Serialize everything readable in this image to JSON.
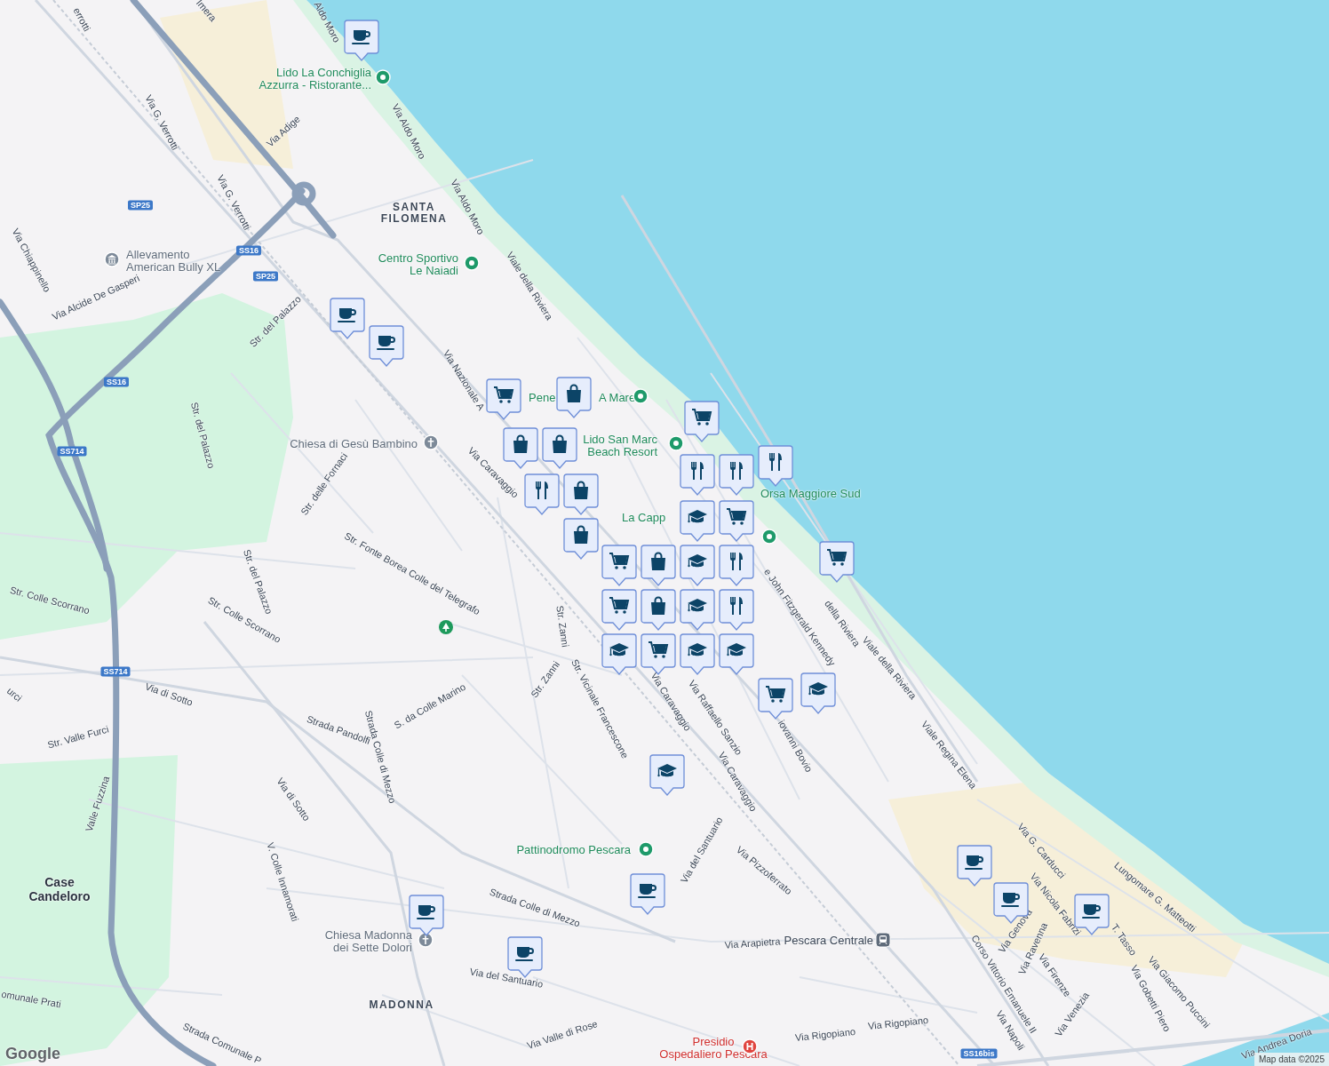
{
  "map": {
    "street_labels": [
      "errotti",
      "Imera",
      "Aldo Moro",
      "Via G. Verrotti",
      "Via Adige",
      "Via Aldo Moro",
      "Via G. Verrotti",
      "Via Aldo Moro",
      "Viale della Riviera",
      "Via Chiappinello",
      "Via Alcide De Gasperi",
      "Str. del Palazzo",
      "Via Nazionale A",
      "Str. del Palazzo",
      "Str. delle Fornaci",
      "Via Caravaggio",
      "Str. Fonte Borea Colle del Telegrafo",
      "Str. del Palazzo",
      "Str. Colle Scorrano",
      "Str. Colle Scorrano",
      "Str. Zanni",
      "Str. Zanni",
      "Str. Vicinale Francescone",
      "Via Caravaggio",
      "Via Raffaello Sanzio",
      "iovanni Bovio",
      "e John Fitzgerald Kennedy",
      "della Riviera",
      "Viale della Riviera",
      "Viale Regina Elena",
      "urci",
      "Via di Sotto",
      "Strada Pandolfi",
      "S. da Colle Marino",
      "Strada Colle di Mezzo",
      "Str. Valle Furci",
      "Valle Fuzzina",
      "Via di Sotto",
      "V. Colle Innamorati",
      "Via Caravaggio",
      "Via del Santuario",
      "Via Pizzoferrato",
      "Strada Colle di Mezzo",
      "Via Arapietra",
      "Via del Santuario",
      "Via Valle di Rose",
      "Via Rigopiano",
      "Via Rigopiano",
      "Strada Comunale P",
      "omunale Prati",
      "Via G. Carducci",
      "Via Nicola Fabrizi",
      "Lungomare G. Matteotti",
      "Via Genova",
      "Via Ravenna",
      "Corso Vittorio Emanuele II",
      "Via Firenze",
      "T. Tasso",
      "Via Giacomo Puccini",
      "Via Gobetti Piero",
      "Via Venezia",
      "Via Napoli",
      "Via Andrea Doria"
    ],
    "places": [
      {
        "kind": "poi",
        "lines": [
          "Lido La Conchiglia",
          "Azzurra -  Ristorante..."
        ]
      },
      {
        "kind": "poi",
        "lines": [
          "Centro Sportivo",
          "Le Naiadi"
        ]
      },
      {
        "kind": "poi",
        "lines": [
          "Pene"
        ]
      },
      {
        "kind": "poi",
        "lines": [
          "A Mare"
        ]
      },
      {
        "kind": "poi",
        "lines": [
          "Lido San Marc",
          "Beach Resort"
        ]
      },
      {
        "kind": "poi",
        "lines": [
          "Orsa Maggiore Sud"
        ]
      },
      {
        "kind": "poi",
        "lines": [
          "La Capp"
        ]
      },
      {
        "kind": "poi",
        "lines": [
          "Pattinodromo Pescara"
        ]
      },
      {
        "kind": "museum",
        "lines": [
          "Allevamento",
          "American Bully XL"
        ]
      },
      {
        "kind": "church",
        "lines": [
          "Chiesa di Gesù Bambino"
        ]
      },
      {
        "kind": "church",
        "lines": [
          "Chiesa Madonna",
          "dei Sette Dolori"
        ]
      },
      {
        "kind": "station",
        "lines": [
          "Pescara Centrale"
        ]
      },
      {
        "kind": "hospital",
        "lines": [
          "Presidio",
          "Ospedaliero Pescara"
        ]
      },
      {
        "kind": "area",
        "lines": [
          "SANTA",
          "FILOMENA"
        ]
      },
      {
        "kind": "town",
        "lines": [
          "Case",
          "Candeloro"
        ]
      },
      {
        "kind": "area",
        "lines": [
          "MADONNA"
        ]
      }
    ],
    "road_shields": [
      "SP25",
      "SS16",
      "SP25",
      "SS16",
      "SS714",
      "SS714",
      "SS16bis"
    ],
    "markers": [
      {
        "kind": "cafe"
      },
      {
        "kind": "cafe"
      },
      {
        "kind": "cafe"
      },
      {
        "kind": "cart"
      },
      {
        "kind": "bag"
      },
      {
        "kind": "bag"
      },
      {
        "kind": "bag"
      },
      {
        "kind": "fork"
      },
      {
        "kind": "bag"
      },
      {
        "kind": "bag"
      },
      {
        "kind": "cart"
      },
      {
        "kind": "fork"
      },
      {
        "kind": "fork"
      },
      {
        "kind": "school"
      },
      {
        "kind": "fork"
      },
      {
        "kind": "bag"
      },
      {
        "kind": "fork"
      },
      {
        "kind": "cart"
      },
      {
        "kind": "cart"
      },
      {
        "kind": "cart"
      },
      {
        "kind": "school"
      },
      {
        "kind": "cart"
      },
      {
        "kind": "bag"
      },
      {
        "kind": "school"
      },
      {
        "kind": "fork"
      },
      {
        "kind": "school"
      },
      {
        "kind": "cart"
      },
      {
        "kind": "school"
      },
      {
        "kind": "cart"
      },
      {
        "kind": "school"
      },
      {
        "kind": "school"
      },
      {
        "kind": "school"
      },
      {
        "kind": "cafe"
      },
      {
        "kind": "cafe"
      },
      {
        "kind": "cafe"
      },
      {
        "kind": "cafe"
      },
      {
        "kind": "cafe"
      },
      {
        "kind": "cafe"
      }
    ],
    "attribution": {
      "logo": "Google",
      "text": "Map data ©2025"
    }
  }
}
